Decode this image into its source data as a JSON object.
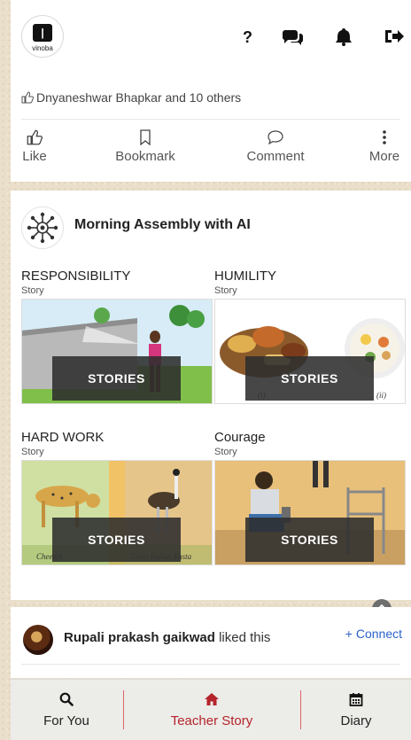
{
  "header": {
    "logo_label": "vinoba",
    "icons": [
      "help-icon",
      "chat-icon",
      "bell-icon",
      "logout-icon"
    ]
  },
  "reactions": {
    "liked_by": "Dnyaneshwar Bhapkar and 10 others",
    "actions": [
      {
        "label": "Like",
        "icon": "thumbs-up-icon"
      },
      {
        "label": "Bookmark",
        "icon": "bookmark-icon"
      },
      {
        "label": "Comment",
        "icon": "comment-icon"
      },
      {
        "label": "More",
        "icon": "more-vertical-icon"
      }
    ]
  },
  "assembly": {
    "title": "Morning Assembly with AI",
    "stories": [
      {
        "title": "RESPONSIBILITY",
        "subtitle": "Story",
        "badge": "STORIES"
      },
      {
        "title": "HUMILITY",
        "subtitle": "Story",
        "badge": "STORIES",
        "caption_left": "(i)",
        "caption_right": "(ii)"
      },
      {
        "title": "HARD WORK",
        "subtitle": "Story",
        "badge": "STORIES",
        "caption_left": "Cheetah",
        "caption_right": "Great Indian Busta"
      },
      {
        "title": "Courage",
        "subtitle": "Story",
        "badge": "STORIES"
      }
    ]
  },
  "activity": {
    "user": "Rupali prakash gaikwad",
    "action": "liked this",
    "connect": "+ Connect"
  },
  "nav": {
    "tabs": [
      {
        "label": "For You",
        "icon": "search-icon"
      },
      {
        "label": "Teacher Story",
        "icon": "home-icon"
      },
      {
        "label": "Diary",
        "icon": "calendar-icon"
      }
    ],
    "active_color": "#b5242a"
  }
}
